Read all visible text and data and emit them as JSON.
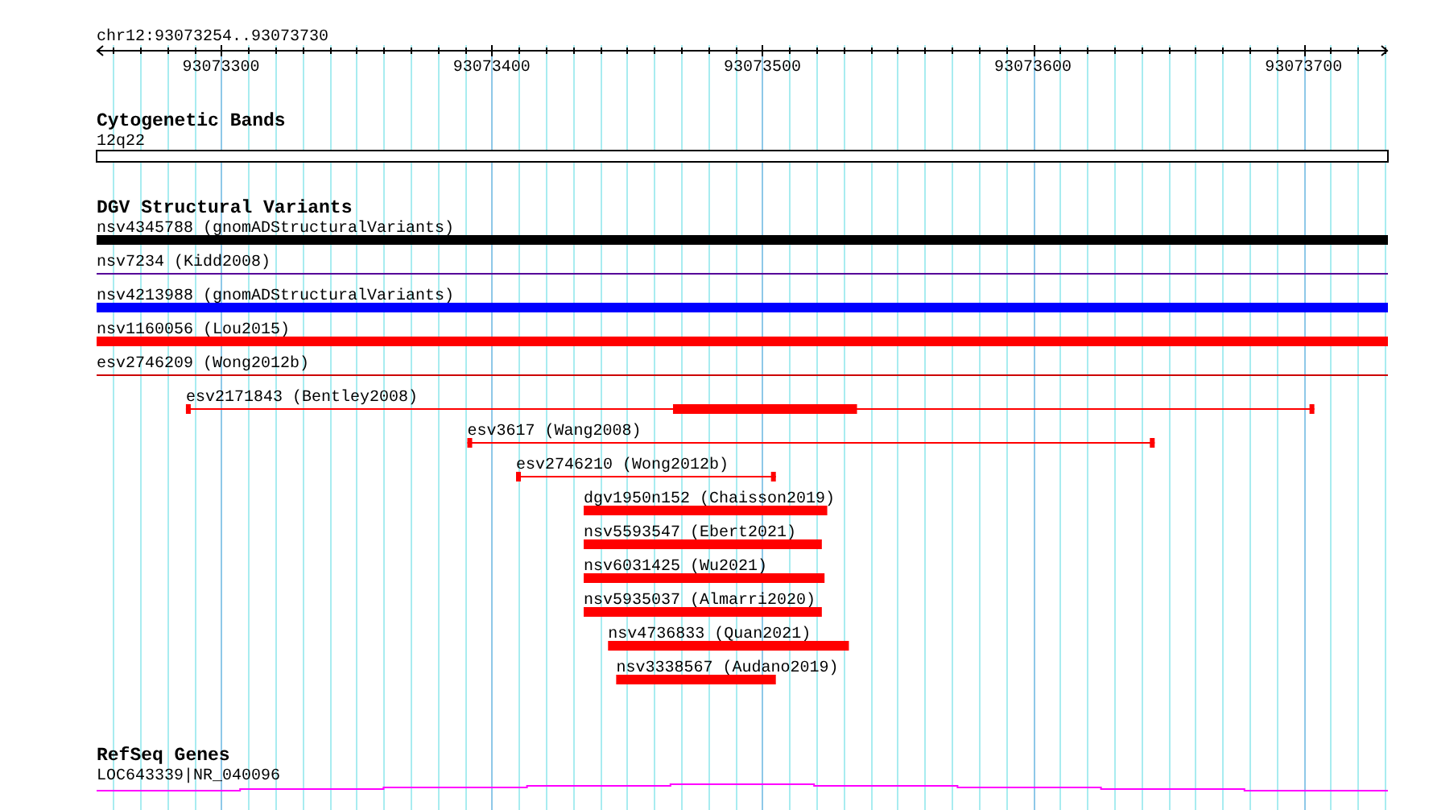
{
  "location": "chr12:93073254..93073730",
  "ruler": {
    "ticks": [
      "93073300",
      "93073400",
      "93073500",
      "93073600",
      "93073700"
    ]
  },
  "tracks": [
    {
      "title": "Cytogenetic Bands",
      "features": [
        {
          "label": "12q22",
          "kind": "band",
          "color": "#000000"
        }
      ]
    },
    {
      "title": "DGV Structural Variants",
      "features": [
        {
          "label": "nsv4345788 (gnomADStructuralVariants)",
          "kind": "bar",
          "color": "#000000"
        },
        {
          "label": "nsv7234 (Kidd2008)",
          "kind": "line",
          "color": "#550099"
        },
        {
          "label": "nsv4213988 (gnomADStructuralVariants)",
          "kind": "bar",
          "color": "#0000ff"
        },
        {
          "label": "nsv1160056 (Lou2015)",
          "kind": "bar",
          "color": "#ff0000"
        },
        {
          "label": "esv2746209 (Wong2012b)",
          "kind": "line",
          "color": "#cc0000"
        },
        {
          "label": "esv2171843 (Bentley2008)",
          "kind": "span",
          "color": "#ff0000"
        },
        {
          "label": "esv3617 (Wang2008)",
          "kind": "span",
          "color": "#ff0000"
        },
        {
          "label": "esv2746210 (Wong2012b)",
          "kind": "span",
          "color": "#ff0000"
        },
        {
          "label": "dgv1950n152 (Chaisson2019)",
          "kind": "bar",
          "color": "#ff0000"
        },
        {
          "label": "nsv5593547 (Ebert2021)",
          "kind": "bar",
          "color": "#ff0000"
        },
        {
          "label": "nsv6031425 (Wu2021)",
          "kind": "bar",
          "color": "#ff0000"
        },
        {
          "label": "nsv5935037 (Almarri2020)",
          "kind": "bar",
          "color": "#ff0000"
        },
        {
          "label": "nsv4736833 (Quan2021)",
          "kind": "bar",
          "color": "#ff0000"
        },
        {
          "label": "nsv3338567 (Audano2019)",
          "kind": "bar",
          "color": "#ff0000"
        }
      ]
    },
    {
      "title": "RefSeq Genes",
      "features": [
        {
          "label": "LOC643339|NR_040096",
          "kind": "gene",
          "color": "#ff00ff"
        }
      ]
    }
  ]
}
